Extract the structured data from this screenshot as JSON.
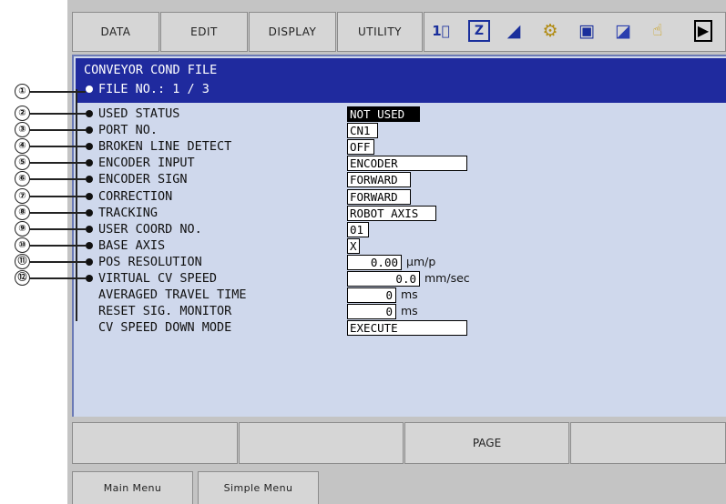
{
  "menu": {
    "data": "DATA",
    "edit": "EDIT",
    "display": "DISPLAY",
    "utility": "UTILITY"
  },
  "status_icons": [
    "numbers-icon",
    "edit-mode-icon",
    "signal-icon",
    "gear-icon",
    "camera-icon",
    "cursor-icon",
    "hand-icon",
    "play-icon"
  ],
  "header": {
    "title": "CONVEYOR COND FILE",
    "file_no": "FILE NO.: 1 / 3"
  },
  "callouts": [
    "①",
    "②",
    "③",
    "④",
    "⑤",
    "⑥",
    "⑦",
    "⑧",
    "⑨",
    "⑩",
    "⑪",
    "⑫"
  ],
  "rows": [
    {
      "label": "USED STATUS",
      "value": "NOT USED"
    },
    {
      "label": "PORT NO.",
      "value": "CN1"
    },
    {
      "label": "BROKEN LINE DETECT",
      "value": "OFF"
    },
    {
      "label": "ENCODER INPUT",
      "value": "ENCODER"
    },
    {
      "label": "ENCODER SIGN",
      "value": "FORWARD"
    },
    {
      "label": "CORRECTION",
      "value": "FORWARD"
    },
    {
      "label": "TRACKING",
      "value": "ROBOT AXIS"
    },
    {
      "label": "USER COORD NO.",
      "value": "01"
    },
    {
      "label": "BASE AXIS",
      "value": "X"
    },
    {
      "label": "POS RESOLUTION",
      "value": "0.00",
      "unit": "μm/p"
    },
    {
      "label": "VIRTUAL CV SPEED",
      "value": "0.0",
      "unit": "mm/sec"
    },
    {
      "label": "AVERAGED TRAVEL TIME",
      "value": "0",
      "unit": "ms"
    },
    {
      "label": "RESET SIG. MONITOR",
      "value": "0",
      "unit": "ms"
    },
    {
      "label": "CV SPEED DOWN MODE",
      "value": "EXECUTE"
    }
  ],
  "function_bar": {
    "f1": "",
    "f2": "",
    "f3": "PAGE",
    "f4": ""
  },
  "main_menu": {
    "main": "Main Menu",
    "simple": "Simple Menu"
  }
}
